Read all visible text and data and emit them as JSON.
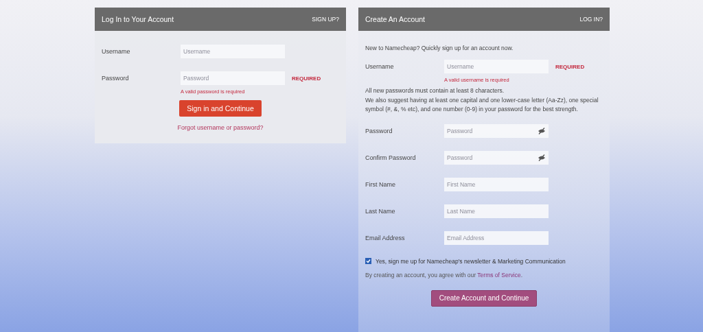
{
  "login": {
    "title": "Log In to Your Account",
    "switch_link": "SIGN UP?",
    "fields": [
      {
        "kind": "text",
        "label": "Username",
        "placeholder": "Username"
      },
      {
        "kind": "text",
        "label": "Password",
        "placeholder": "Password",
        "flag": "REQUIRED",
        "error": "A valid password is required"
      }
    ],
    "submit": "Sign in and Continue",
    "forgot_link": "Forgot username or password?"
  },
  "signup": {
    "title": "Create An Account",
    "switch_link": "LOG IN?",
    "intro": "New to Namecheap? Quickly sign up for an account now.",
    "username": {
      "kind": "text",
      "label": "Username",
      "placeholder": "Username",
      "flag": "REQUIRED",
      "error": "A valid username is required"
    },
    "password_rules": [
      "All new passwords must contain at least 8 characters.",
      "We also suggest having at least one capital and one lower-case letter (Aa-Zz), one special symbol (#, &, % etc), and one number (0-9) in your password for the best strength."
    ],
    "fields": [
      {
        "kind": "password",
        "label": "Password",
        "placeholder": "Password"
      },
      {
        "kind": "password",
        "label": "Confirm Password",
        "placeholder": "Password"
      },
      {
        "kind": "text",
        "label": "First Name",
        "placeholder": "First Name"
      },
      {
        "kind": "text",
        "label": "Last Name",
        "placeholder": "Last Name"
      },
      {
        "kind": "text",
        "label": "Email Address",
        "placeholder": "Email Address"
      }
    ],
    "newsletter": {
      "label": "Yes, sign me up for Namecheap's newsletter & Marketing Communication",
      "checked": true
    },
    "terms": {
      "before": "By creating an account, you agree with our ",
      "link": "Terms of Service",
      "after": "."
    },
    "submit": "Create Account and Continue"
  }
}
